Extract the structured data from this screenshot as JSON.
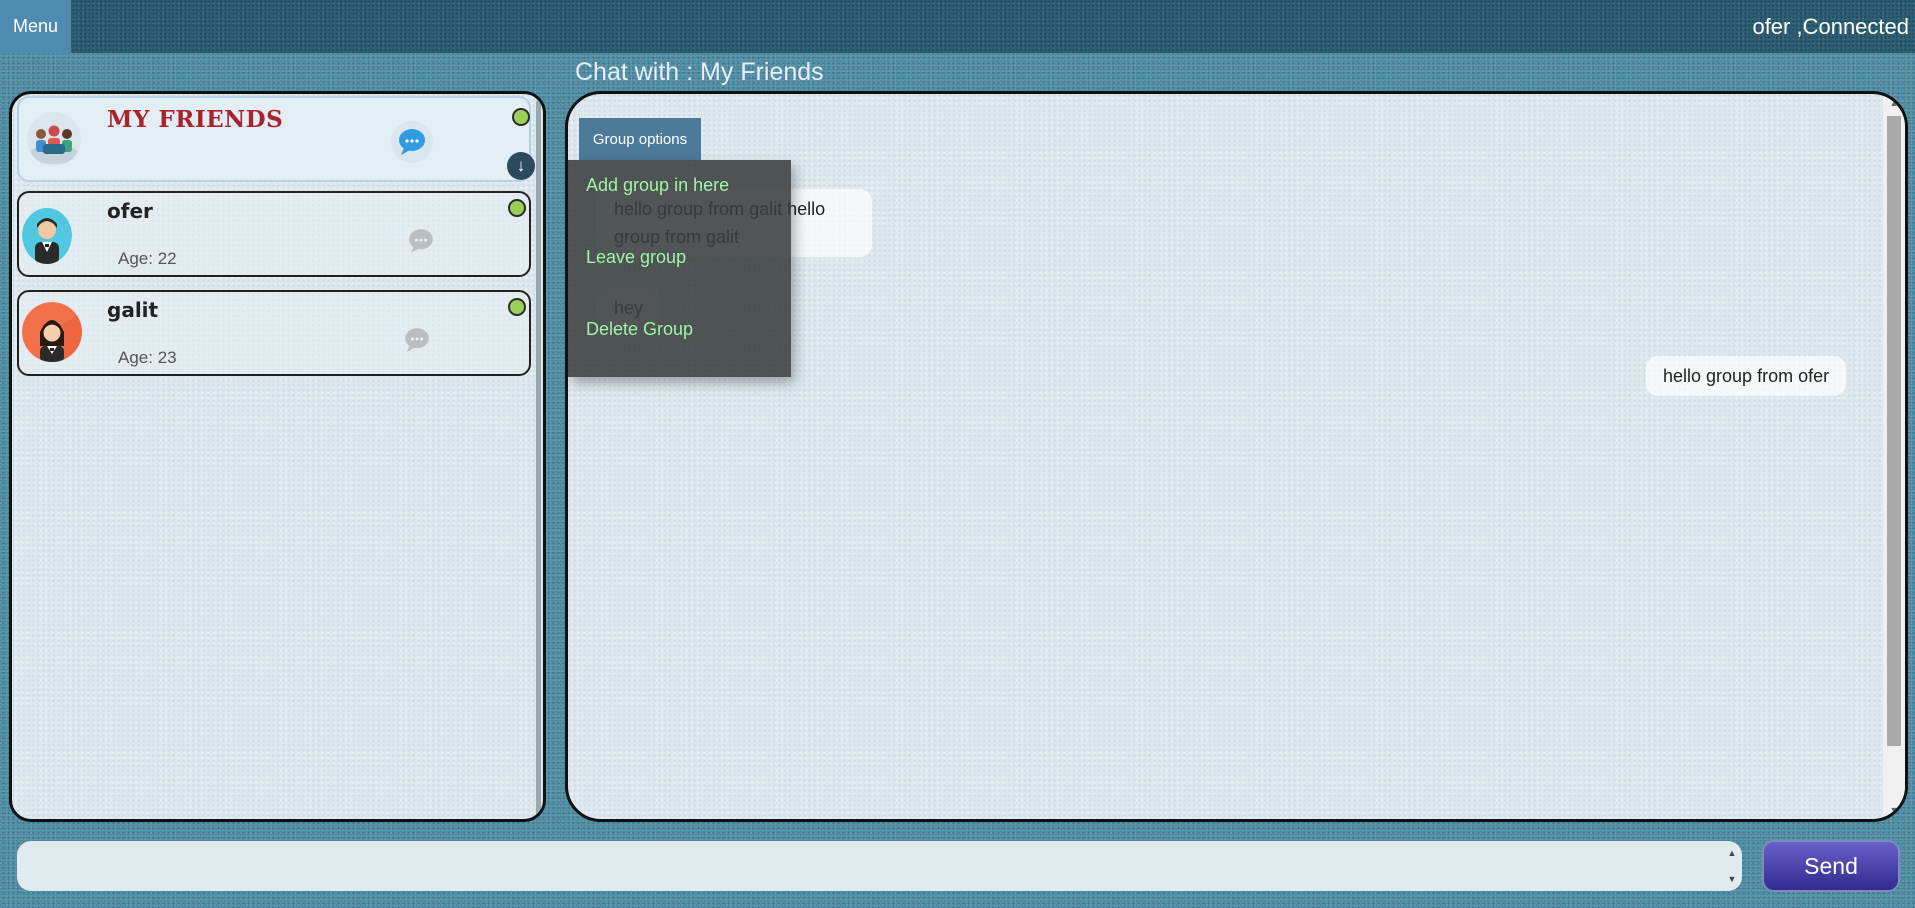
{
  "topbar": {
    "menu_label": "Menu",
    "user_status": "ofer ,Connected"
  },
  "chat_title": "Chat with : My Friends",
  "friends": {
    "group": {
      "name": "MY FRIENDS",
      "status_color": "#9ccf58",
      "icon": "group-avatar-icon"
    },
    "items": [
      {
        "name": "ofer",
        "age": "Age: 22",
        "status_color": "#9ccf58"
      },
      {
        "name": "galit",
        "age": "Age: 23",
        "status_color": "#9ccf58"
      }
    ]
  },
  "chat": {
    "group_options_label": "Group options",
    "dropdown": {
      "items": [
        "Add group in here",
        "Leave group",
        "Delete Group"
      ]
    },
    "messages": [
      {
        "text": "hello group from galit hello group from galit",
        "side": "left"
      },
      {
        "text": "hey",
        "side": "left"
      },
      {
        "text": "hello group from ofer",
        "side": "right"
      }
    ]
  },
  "composer": {
    "input_value": "",
    "send_label": "Send"
  }
}
